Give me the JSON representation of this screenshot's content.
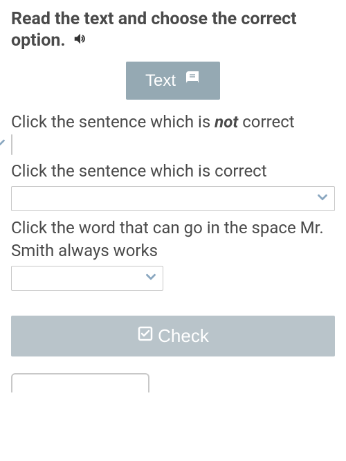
{
  "instruction": {
    "text": "Read the text and choose the correct option."
  },
  "text_button": {
    "label": "Text"
  },
  "questions": {
    "q1_pre": "Click the sentence which is ",
    "q1_em": "not",
    "q1_post": " correct ",
    "q2": "Click the sentence which is correct",
    "q3": "Click the word that can go in the space Mr. Smith always works"
  },
  "check_button": {
    "label": "Check"
  }
}
